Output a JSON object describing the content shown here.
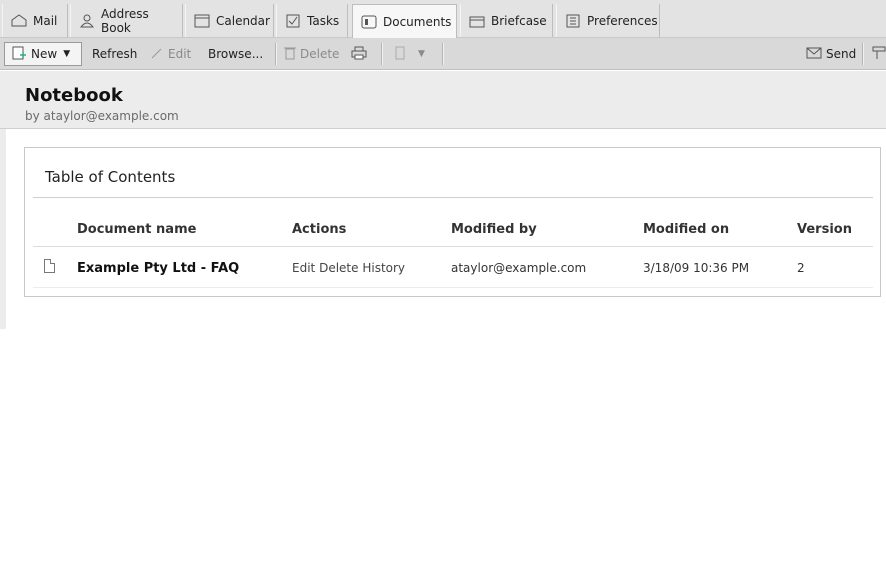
{
  "tabs": [
    {
      "label": "Mail",
      "icon": "mail-icon"
    },
    {
      "label": "Address Book",
      "icon": "address-book-icon"
    },
    {
      "label": "Calendar",
      "icon": "calendar-icon"
    },
    {
      "label": "Tasks",
      "icon": "tasks-icon"
    },
    {
      "label": "Documents",
      "icon": "documents-icon",
      "active": true
    },
    {
      "label": "Briefcase",
      "icon": "briefcase-icon"
    },
    {
      "label": "Preferences",
      "icon": "preferences-icon"
    }
  ],
  "toolbar": {
    "new_label": "New",
    "refresh_label": "Refresh",
    "edit_label": "Edit",
    "browse_label": "Browse...",
    "delete_label": "Delete",
    "send_label": "Send"
  },
  "header": {
    "title": "Notebook",
    "byline": "by ataylor@example.com"
  },
  "toc": {
    "title": "Table of Contents",
    "columns": [
      "Document name",
      "Actions",
      "Modified by",
      "Modified on",
      "Version"
    ],
    "rows": [
      {
        "name": "Example Pty Ltd - FAQ",
        "actions": [
          "Edit",
          "Delete",
          "History"
        ],
        "modified_by": "ataylor@example.com",
        "modified_on": "3/18/09 10:36 PM",
        "version": "2"
      }
    ]
  }
}
